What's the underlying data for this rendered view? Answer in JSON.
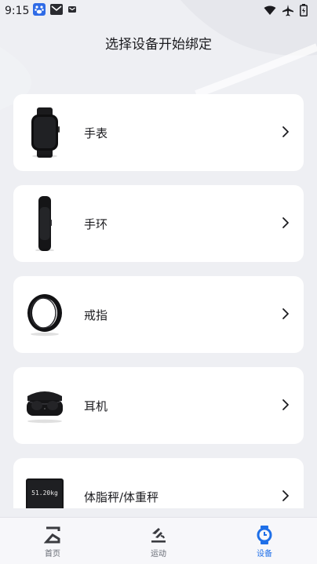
{
  "status_bar": {
    "time": "9:15"
  },
  "header": {
    "title": "选择设备开始绑定"
  },
  "devices": [
    {
      "label": "手表",
      "icon": "smartwatch-icon"
    },
    {
      "label": "手环",
      "icon": "fitness-band-icon"
    },
    {
      "label": "戒指",
      "icon": "smart-ring-icon"
    },
    {
      "label": "耳机",
      "icon": "earbuds-icon"
    },
    {
      "label": "体脂秤/体重秤",
      "icon": "body-scale-icon",
      "scale_reading": "51.20kg"
    }
  ],
  "nav": {
    "items": [
      {
        "label": "首页",
        "icon": "home-sigma-icon",
        "active": false
      },
      {
        "label": "运动",
        "icon": "running-icon",
        "active": false
      },
      {
        "label": "设备",
        "icon": "watch-device-icon",
        "active": true
      }
    ]
  },
  "colors": {
    "accent": "#1e6fe8",
    "background": "#eeeff3",
    "card": "#ffffff"
  }
}
